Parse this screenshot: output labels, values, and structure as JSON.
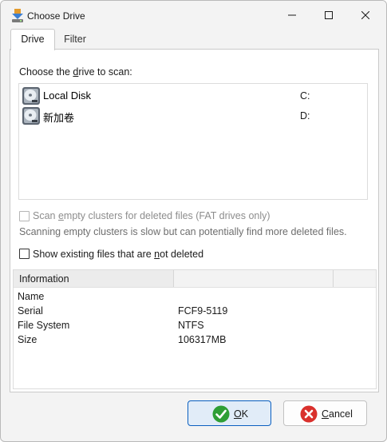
{
  "window": {
    "title": "Choose Drive"
  },
  "tabs": [
    {
      "label": "Drive",
      "active": true
    },
    {
      "label": "Filter",
      "active": false
    }
  ],
  "drive_panel": {
    "choose_prefix": "Choose the ",
    "choose_underlined": "d",
    "choose_suffix": "rive to scan:",
    "drives": [
      {
        "name": "Local Disk",
        "letter": "C:",
        "icon": "hard-drive-icon"
      },
      {
        "name": "新加卷",
        "letter": "D:",
        "icon": "hard-drive-icon"
      }
    ],
    "scan_empty": {
      "prefix": "Scan ",
      "underlined": "e",
      "suffix": "mpty clusters for deleted files (FAT drives only)",
      "checked": false,
      "enabled": false
    },
    "hint": "Scanning empty clusters is slow but can potentially find more deleted files.",
    "show_existing": {
      "prefix": "Show existing files that are ",
      "underlined": "n",
      "suffix": "ot deleted",
      "checked": false,
      "enabled": true
    }
  },
  "information": {
    "header": "Information",
    "rows": [
      {
        "key": "Name",
        "value": ""
      },
      {
        "key": "Serial",
        "value": "FCF9-5119"
      },
      {
        "key": "File System",
        "value": "NTFS"
      },
      {
        "key": "Size",
        "value": "106317MB"
      }
    ]
  },
  "buttons": {
    "ok": {
      "underlined": "O",
      "rest": "K"
    },
    "cancel": {
      "underlined": "C",
      "rest": "ancel"
    }
  },
  "colors": {
    "accent": "#0a5fc0",
    "ok_green": "#2e9e35",
    "cancel_red": "#d9302c"
  }
}
